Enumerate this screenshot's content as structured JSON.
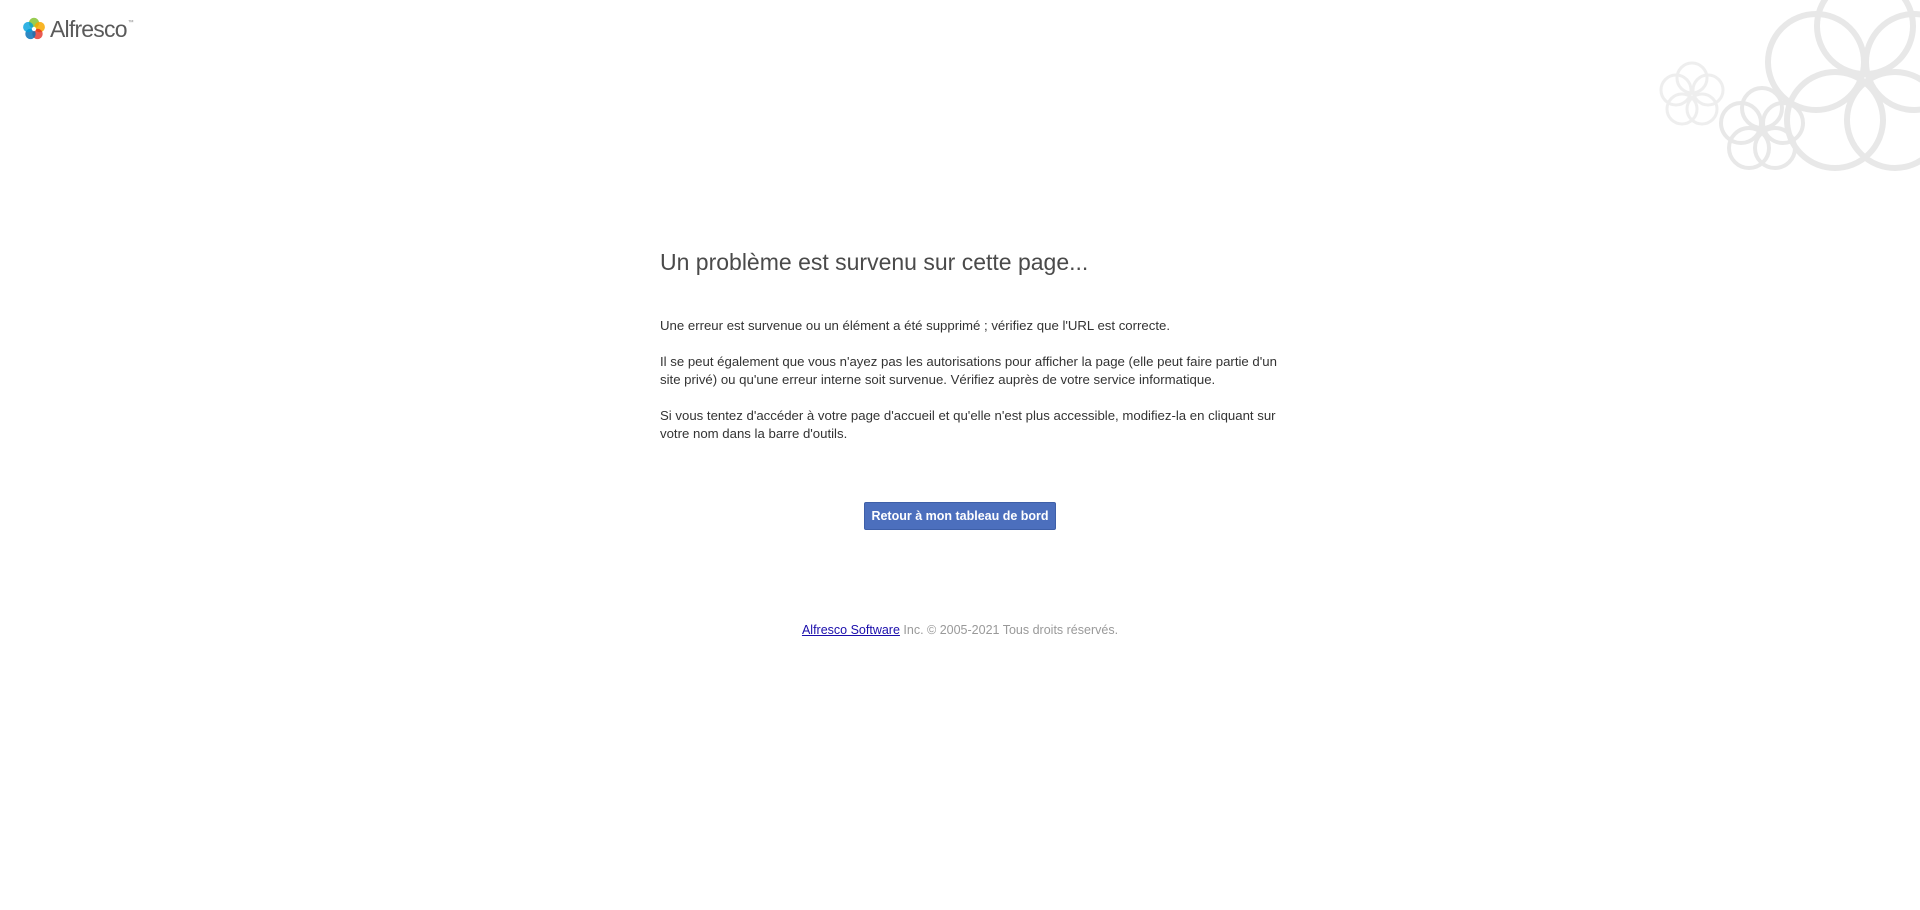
{
  "header": {
    "logo_text": "Alfresco",
    "logo_tm": "™",
    "logo_icon": "alfresco-flower-icon",
    "decoration_icon": "flower-outline-icon"
  },
  "main": {
    "title": "Un problème est survenu sur cette page...",
    "paragraphs": [
      "Une erreur est survenue ou un élément a été supprimé ; vérifiez que l'URL est correcte.",
      "Il se peut également que vous n'ayez pas les autorisations pour afficher la page (elle peut faire partie d'un site privé) ou qu'une erreur interne soit survenue. Vérifiez auprès de votre service informatique.",
      "Si vous tentez d'accéder à votre page d'accueil et qu'elle n'est plus accessible, modifiez-la en cliquant sur votre nom dans la barre d'outils."
    ],
    "button_label": "Retour à mon tableau de bord"
  },
  "footer": {
    "link_text": "Alfresco Software",
    "copyright": " Inc. © 2005-2021 Tous droits réservés."
  },
  "colors": {
    "button_bg": "#4c6fbd",
    "title": "#4a4a4a",
    "footer_text": "#999999",
    "link": "#1a0dab",
    "decor": "#e6e6e6"
  }
}
